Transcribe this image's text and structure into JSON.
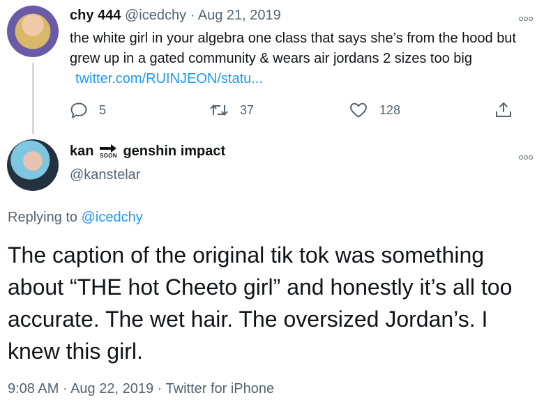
{
  "tweet1": {
    "display_name": "chy 444",
    "handle": "@icedchy",
    "separator": "·",
    "date": "Aug 21, 2019",
    "text": "the white girl in your algebra one class that says she’s from the hood but grew up in a gated community & wears air jordans 2 sizes too big",
    "link": "twitter.com/RUINJEON/statu...",
    "replies": "5",
    "retweets": "37",
    "likes": "128"
  },
  "tweet2": {
    "display_name_part1": "kan",
    "badge_text": "SOON",
    "display_name_part2": "genshin impact",
    "handle": "@kanstelar",
    "replying_prefix": "Replying to",
    "replying_to": "@icedchy",
    "text": "The caption of the original tik tok was something about “THE hot Cheeto girl” and honestly it’s all too accurate. The wet hair. The oversized Jordan’s. I knew this girl.",
    "time": "9:08 AM",
    "separator": "·",
    "date": "Aug 22, 2019",
    "source": "Twitter for iPhone"
  },
  "colors": {
    "accent": "#1d9bf0",
    "muted": "#536471",
    "text": "#0f1419"
  },
  "icons": [
    "reply-icon",
    "retweet-icon",
    "like-icon",
    "share-icon",
    "more-icon",
    "soon-arrow-icon"
  ]
}
